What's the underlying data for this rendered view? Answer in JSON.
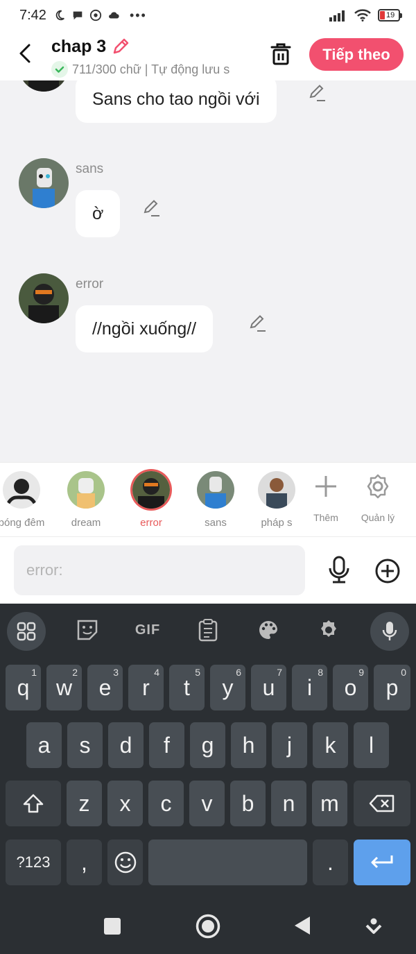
{
  "status_bar": {
    "time": "7:42",
    "battery": "19"
  },
  "header": {
    "title": "chap 3",
    "subtitle": "711/300 chữ | Tự động lưu s",
    "next_label": "Tiếp theo"
  },
  "messages": [
    {
      "sender": "",
      "text": "Sans cho tao ngồi với"
    },
    {
      "sender": "sans",
      "text": "ờ"
    },
    {
      "sender": "error",
      "text": "//ngồi xuống//"
    }
  ],
  "characters": [
    {
      "name": "bóng đêm"
    },
    {
      "name": "dream"
    },
    {
      "name": "error",
      "active": true
    },
    {
      "name": "sans"
    },
    {
      "name": "pháp s"
    }
  ],
  "tools": {
    "add_label": "Thêm",
    "manage_label": "Quản lý"
  },
  "input": {
    "placeholder": "error:"
  },
  "keyboard": {
    "row1": [
      {
        "key": "q",
        "hint": "1"
      },
      {
        "key": "w",
        "hint": "2"
      },
      {
        "key": "e",
        "hint": "3"
      },
      {
        "key": "r",
        "hint": "4"
      },
      {
        "key": "t",
        "hint": "5"
      },
      {
        "key": "y",
        "hint": "6"
      },
      {
        "key": "u",
        "hint": "7"
      },
      {
        "key": "i",
        "hint": "8"
      },
      {
        "key": "o",
        "hint": "9"
      },
      {
        "key": "p",
        "hint": "0"
      }
    ],
    "row2": [
      "a",
      "s",
      "d",
      "f",
      "g",
      "h",
      "j",
      "k",
      "l"
    ],
    "row3": [
      "z",
      "x",
      "c",
      "v",
      "b",
      "n",
      "m"
    ],
    "symbols_label": "?123",
    "comma": ",",
    "period": ".",
    "gif_label": "GIF"
  }
}
